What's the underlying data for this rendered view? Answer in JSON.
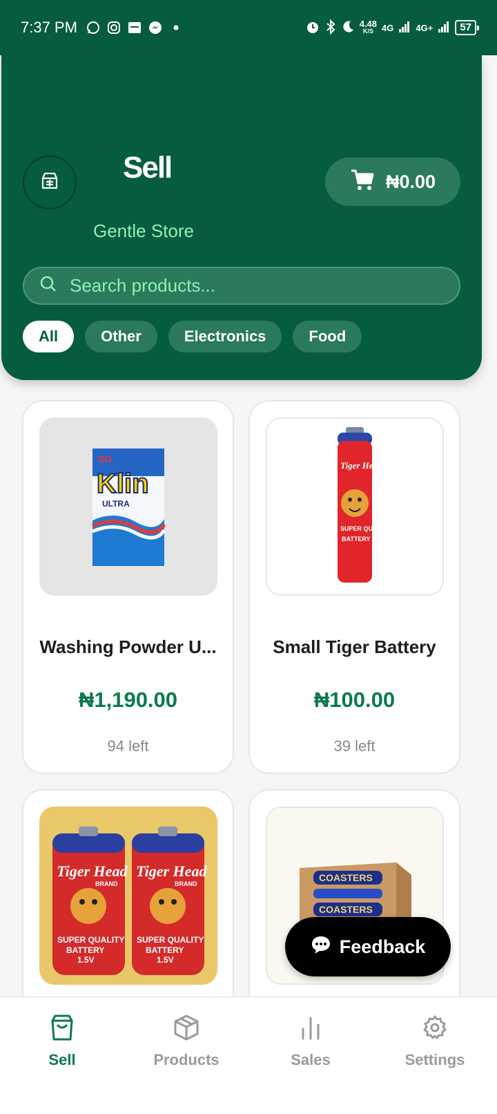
{
  "status_bar": {
    "time": "7:37 PM",
    "net_speed_top": "4.48",
    "net_speed_bottom": "K/S",
    "net1": "4G",
    "net2": "4G+",
    "battery": "57"
  },
  "header": {
    "title": "Sell",
    "store_name": "Gentle Store",
    "cart_total": "₦0.00"
  },
  "search": {
    "placeholder": "Search products..."
  },
  "categories": [
    {
      "label": "All",
      "active": true
    },
    {
      "label": "Other",
      "active": false
    },
    {
      "label": "Electronics",
      "active": false
    },
    {
      "label": "Food",
      "active": false
    }
  ],
  "products": [
    {
      "name": "Washing Powder U...",
      "price": "₦1,190.00",
      "stock": "94 left",
      "image": "klin-detergent"
    },
    {
      "name": "Small Tiger Battery",
      "price": "₦100.00",
      "stock": "39 left",
      "image": "tiger-aa-battery"
    },
    {
      "name": "",
      "price": "",
      "stock": "",
      "image": "tiger-big-batteries"
    },
    {
      "name": "",
      "price": "",
      "stock": "",
      "image": "coasters-box"
    }
  ],
  "product_image_text": {
    "klin_top": "SO",
    "klin_brand": "Klin",
    "klin_line": "ULTRA",
    "tiger_brand": "Tiger Head",
    "tiger_sub": "BRAND",
    "tiger_quality": "SUPER QUALITY",
    "tiger_battery": "BATTERY",
    "tiger_volt": "1.5V",
    "coasters": "COASTERS"
  },
  "feedback_label": "Feedback",
  "bottom_nav": [
    {
      "label": "Sell",
      "icon": "shopping-bag-icon",
      "active": true
    },
    {
      "label": "Products",
      "icon": "box-icon",
      "active": false
    },
    {
      "label": "Sales",
      "icon": "bar-chart-icon",
      "active": false
    },
    {
      "label": "Settings",
      "icon": "gear-icon",
      "active": false
    }
  ],
  "colors": {
    "primary": "#065c3e",
    "accent": "#0a7a4c",
    "muted_green": "#8ff0b6"
  }
}
